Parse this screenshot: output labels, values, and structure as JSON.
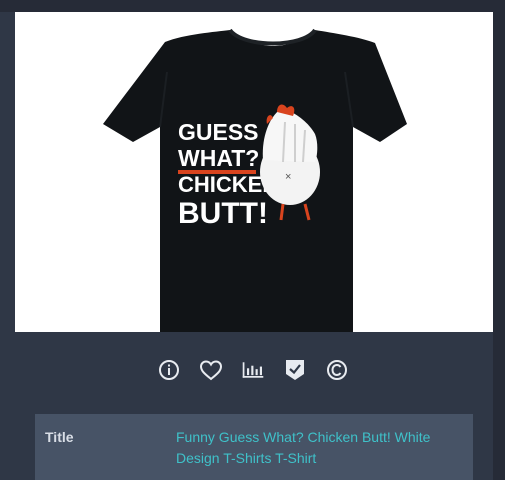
{
  "product": {
    "shirt_text": {
      "line1": "GUESS",
      "line2": "WHAT?",
      "line3": "CHICKEN",
      "line4": "BUTT!"
    },
    "colors": {
      "shirt": "#111417",
      "accent_orange": "#d9441e",
      "value_link": "#3fc1c9"
    }
  },
  "actions": [
    {
      "icon": "info-icon"
    },
    {
      "icon": "heart-icon"
    },
    {
      "icon": "bar-chart-icon"
    },
    {
      "icon": "check-badge-icon"
    },
    {
      "icon": "copyright-icon"
    }
  ],
  "details": {
    "title_label": "Title",
    "title_value": "Funny Guess What? Chicken Butt! White Design T-Shirts T-Shirt"
  }
}
